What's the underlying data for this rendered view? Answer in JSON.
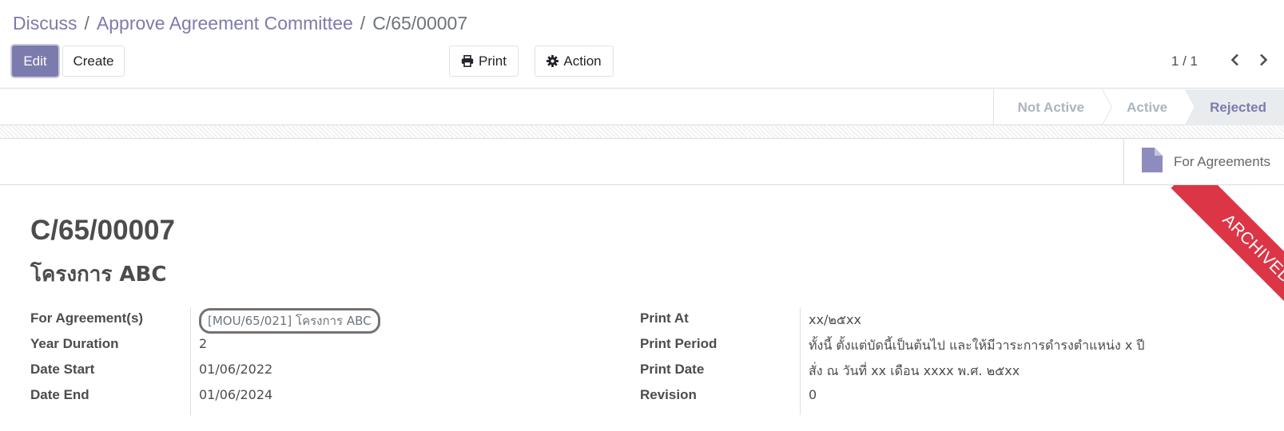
{
  "breadcrumb": {
    "items": [
      "Discuss",
      "Approve Agreement Committee"
    ],
    "current": "C/65/00007",
    "separator": "/"
  },
  "toolbar": {
    "edit_label": "Edit",
    "create_label": "Create",
    "print_label": "Print",
    "action_label": "Action"
  },
  "pager": {
    "value": "1 / 1"
  },
  "statusbar": {
    "steps": [
      "Not Active",
      "Active",
      "Rejected"
    ],
    "current": "Rejected"
  },
  "smart_button": {
    "label": "For Agreements",
    "icon": "file-icon"
  },
  "ribbon": {
    "text": "ARCHIVED",
    "color": "#dc3545"
  },
  "record": {
    "name": "C/65/00007",
    "subtitle": "โครงการ ABC"
  },
  "fields_left": [
    {
      "label": "For Agreement(s)",
      "value": "[MOU/65/021] โครงการ ABC"
    },
    {
      "label": "Year Duration",
      "value": "2"
    },
    {
      "label": "Date Start",
      "value": "01/06/2022"
    },
    {
      "label": "Date End",
      "value": "01/06/2024"
    }
  ],
  "fields_right": [
    {
      "label": "Print At",
      "value": "xx/๒๕xx"
    },
    {
      "label": "Print Period",
      "value": "ทั้งนี้ ตั้งแต่บัดนี้เป็นต้นไป และให้มีวาระการดำรงตำแหน่ง x ปี"
    },
    {
      "label": "Print Date",
      "value": "สั่ง ณ วันที่ xx เดือน xxxx พ.ศ. ๒๕xx"
    },
    {
      "label": "Revision",
      "value": "0"
    }
  ],
  "colors": {
    "primary": "#7c7bad",
    "ribbon": "#dc3545",
    "text": "#4c4c4c"
  }
}
